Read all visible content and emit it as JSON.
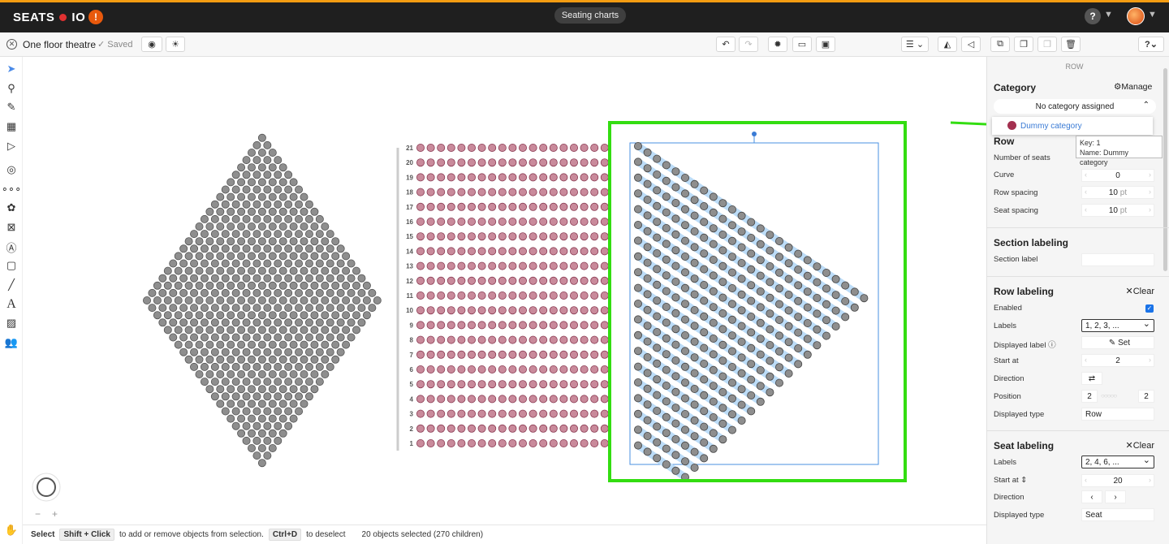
{
  "topbar": {
    "logo_left": "SEATS",
    "logo_right": "IO",
    "logo_alert": "!",
    "nav_pill": "Seating charts",
    "help": "?"
  },
  "toolbar": {
    "doc_title": "One floor theatre",
    "saved": "Saved",
    "help": "?"
  },
  "chart": {
    "row_labels": [
      "21",
      "20",
      "19",
      "18",
      "17",
      "16",
      "15",
      "14",
      "13",
      "12",
      "11",
      "10",
      "9",
      "8",
      "7",
      "6",
      "5",
      "4",
      "3",
      "2",
      "1"
    ],
    "seat_colors": {
      "grey": "#8e8e8e",
      "pink": "#c98a9b",
      "selection": "#3a7bd5",
      "highlight": "#33dd11"
    }
  },
  "status": {
    "mode": "Select",
    "key1": "Shift + Click",
    "text1": "to add or remove objects from selection.",
    "key2": "Ctrl+D",
    "text2": "to deselect",
    "selection_info": "20 objects selected (270 children)"
  },
  "panel": {
    "header": "ROW",
    "category_title": "Category",
    "manage": "Manage",
    "category_value": "No category assigned",
    "dropdown_option": "Dummy category",
    "tooltip_key": "Key: 1",
    "tooltip_name": "Name: Dummy category",
    "row_title": "Row",
    "number_of_seats": "Number of seats",
    "curve": "Curve",
    "curve_value": "0",
    "row_spacing": "Row spacing",
    "row_spacing_value": "10",
    "seat_spacing": "Seat spacing",
    "seat_spacing_value": "10",
    "unit": "pt",
    "section_labeling": "Section labeling",
    "section_label": "Section label",
    "row_labeling": "Row labeling",
    "clear": "Clear",
    "enabled": "Enabled",
    "labels": "Labels",
    "labels_value": "1, 2, 3, ...",
    "displayed_label": "Displayed label",
    "set": "Set",
    "start_at": "Start at",
    "start_at_value": "2",
    "direction": "Direction",
    "position": "Position",
    "position_left": "2",
    "position_right": "2",
    "displayed_type": "Displayed type",
    "displayed_type_value": "Row",
    "seat_labeling": "Seat labeling",
    "seat_labels_value": "2, 4, 6, ...",
    "seat_start_at_value": "20",
    "seat_displayed_type_value": "Seat"
  }
}
